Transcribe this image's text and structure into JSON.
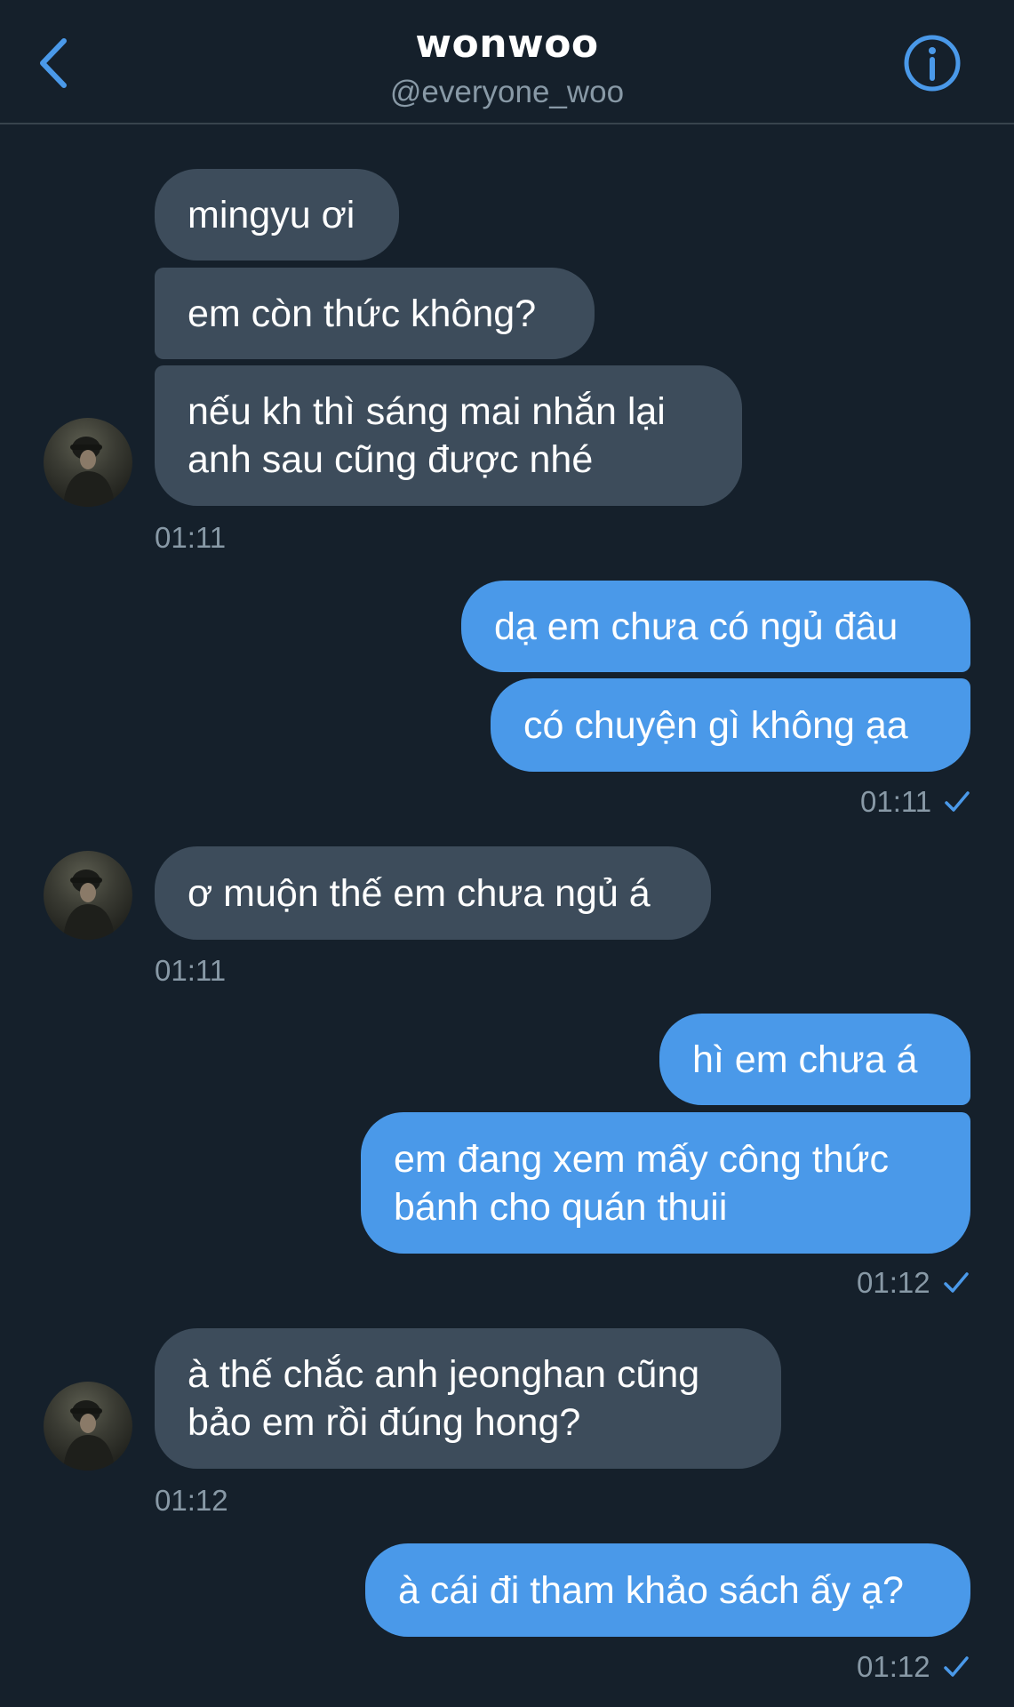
{
  "header": {
    "title": "wonwoo",
    "handle": "@everyone_woo",
    "back_icon": "chevron-left-icon",
    "info_icon": "info-circle-icon"
  },
  "colors": {
    "background": "#15202b",
    "received_bubble": "#3d4c5b",
    "sent_bubble": "#4a99e9",
    "accent": "#4a99e9",
    "timestamp": "#8899a6"
  },
  "messages": [
    {
      "from": "them",
      "text": "mingyu ơi"
    },
    {
      "from": "them",
      "text": "em còn thức không?"
    },
    {
      "from": "them",
      "text": "nếu kh thì sáng mai nhắn lại\nanh sau cũng được nhé"
    },
    {
      "from": "them",
      "time": "01:11"
    },
    {
      "from": "me",
      "text": "dạ em chưa có ngủ đâu"
    },
    {
      "from": "me",
      "text": "có chuyện gì không ạa"
    },
    {
      "from": "me",
      "time": "01:11",
      "read": true
    },
    {
      "from": "them",
      "text": "ơ muộn thế em chưa ngủ á"
    },
    {
      "from": "them",
      "time": "01:11"
    },
    {
      "from": "me",
      "text": "hì em chưa á"
    },
    {
      "from": "me",
      "text": "em đang xem mấy công thức\nbánh cho quán thuii"
    },
    {
      "from": "me",
      "time": "01:12",
      "read": true
    },
    {
      "from": "them",
      "text": "à thế chắc anh jeonghan cũng\nbảo em rồi đúng hong?"
    },
    {
      "from": "them",
      "time": "01:12"
    },
    {
      "from": "me",
      "text": "à cái đi tham khảo sách ấy ạ?"
    },
    {
      "from": "me",
      "time": "01:12",
      "read": true
    }
  ]
}
